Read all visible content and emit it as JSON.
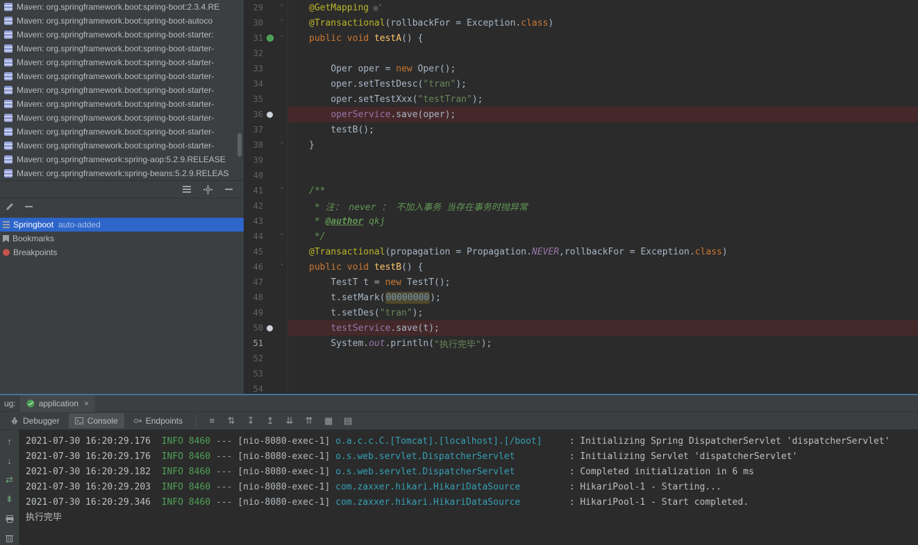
{
  "project_tree": {
    "items": [
      "Maven: org.springframework.boot:spring-boot:2.3.4.RE",
      "Maven: org.springframework.boot:spring-boot-autoco",
      "Maven: org.springframework.boot:spring-boot-starter:",
      "Maven: org.springframework.boot:spring-boot-starter-",
      "Maven: org.springframework.boot:spring-boot-starter-",
      "Maven: org.springframework.boot:spring-boot-starter-",
      "Maven: org.springframework.boot:spring-boot-starter-",
      "Maven: org.springframework.boot:spring-boot-starter-",
      "Maven: org.springframework.boot:spring-boot-starter-",
      "Maven: org.springframework.boot:spring-boot-starter-",
      "Maven: org.springframework.boot:spring-boot-starter-",
      "Maven: org.springframework:spring-aop:5.2.9.RELEASE",
      "Maven: org.springframework:spring-beans:5.2.9.RELEAS"
    ]
  },
  "favorites": {
    "items": [
      {
        "label": "Springboot",
        "suffix": "auto-added",
        "icon": "favorites-list",
        "selected": true
      },
      {
        "label": "Bookmarks",
        "suffix": "",
        "icon": "bookmark",
        "selected": false
      },
      {
        "label": "Breakpoints",
        "suffix": "",
        "icon": "breakpoint",
        "selected": false
      }
    ]
  },
  "editor": {
    "lines": [
      {
        "n": 29,
        "f": "v",
        "t": [
          [
            "a",
            "@GetMapping"
          ],
          [
            "ic",
            " ◎ˇ"
          ]
        ]
      },
      {
        "n": 30,
        "f": "v",
        "t": [
          [
            "a",
            "@Transactional"
          ],
          [
            "p",
            "(rollbackFor = Exception."
          ],
          [
            "k",
            "class"
          ],
          [
            "p",
            ")"
          ]
        ]
      },
      {
        "n": 31,
        "g": "bean",
        "f": "v",
        "t": [
          [
            "k",
            "public"
          ],
          [
            "p",
            " "
          ],
          [
            "k",
            "void"
          ],
          [
            "p",
            " "
          ],
          [
            "m",
            "testA"
          ],
          [
            "p",
            "() {"
          ]
        ]
      },
      {
        "n": 32,
        "t": []
      },
      {
        "n": 33,
        "t": [
          [
            "p",
            "    Oper oper = "
          ],
          [
            "k",
            "new"
          ],
          [
            "p",
            " Oper();"
          ]
        ]
      },
      {
        "n": 34,
        "t": [
          [
            "p",
            "    oper.setTestDesc("
          ],
          [
            "s",
            "\"tran\""
          ],
          [
            "p",
            ");"
          ]
        ]
      },
      {
        "n": 35,
        "t": [
          [
            "p",
            "    oper.setTestXxx("
          ],
          [
            "s",
            "\"testTran\""
          ],
          [
            "p",
            ");"
          ]
        ]
      },
      {
        "n": 36,
        "g": "bp",
        "hl": true,
        "t": [
          [
            "p",
            "    "
          ],
          [
            "f",
            "operService"
          ],
          [
            "p",
            ".save(oper);"
          ]
        ]
      },
      {
        "n": 37,
        "t": [
          [
            "p",
            "    testB();"
          ]
        ]
      },
      {
        "n": 38,
        "f": "^",
        "t": [
          [
            "p",
            "}"
          ]
        ]
      },
      {
        "n": 39,
        "t": []
      },
      {
        "n": 40,
        "t": []
      },
      {
        "n": 41,
        "f": "v",
        "t": [
          [
            "c",
            "/**"
          ]
        ]
      },
      {
        "n": 42,
        "t": [
          [
            "c",
            " * 注： never ： 不加入事务 当存在事务时抛异常"
          ]
        ]
      },
      {
        "n": 43,
        "t": [
          [
            "c",
            " * "
          ],
          [
            "ct",
            "@author"
          ],
          [
            "ci",
            " qkj"
          ]
        ]
      },
      {
        "n": 44,
        "f": "^",
        "t": [
          [
            "c",
            " */"
          ]
        ]
      },
      {
        "n": 45,
        "t": [
          [
            "a",
            "@Transactional"
          ],
          [
            "p",
            "(propagation = Propagation."
          ],
          [
            "fi",
            "NEVER"
          ],
          [
            "p",
            ",rollbackFor = Exception."
          ],
          [
            "k",
            "class"
          ],
          [
            "p",
            ")"
          ]
        ]
      },
      {
        "n": 46,
        "f": "v",
        "t": [
          [
            "k",
            "public"
          ],
          [
            "p",
            " "
          ],
          [
            "k",
            "void"
          ],
          [
            "p",
            " "
          ],
          [
            "m",
            "testB"
          ],
          [
            "p",
            "() {"
          ]
        ]
      },
      {
        "n": 47,
        "t": [
          [
            "p",
            "    TestT t = "
          ],
          [
            "k",
            "new"
          ],
          [
            "p",
            " TestT();"
          ]
        ]
      },
      {
        "n": 48,
        "t": [
          [
            "p",
            "    t.setMark("
          ],
          [
            "nh",
            "00000000"
          ],
          [
            "p",
            ");"
          ]
        ]
      },
      {
        "n": 49,
        "t": [
          [
            "p",
            "    t.setDes("
          ],
          [
            "s",
            "\"tran\""
          ],
          [
            "p",
            ");"
          ]
        ]
      },
      {
        "n": 50,
        "g": "bp",
        "hl": true,
        "t": [
          [
            "p",
            "    "
          ],
          [
            "f",
            "testService"
          ],
          [
            "p",
            ".save(t);"
          ]
        ]
      },
      {
        "n": 51,
        "cur": true,
        "t": [
          [
            "p",
            "    System."
          ],
          [
            "fi",
            "out"
          ],
          [
            "p",
            ".println("
          ],
          [
            "s",
            "\"执行完毕\""
          ],
          [
            "p",
            ");"
          ]
        ]
      },
      {
        "n": 52,
        "t": []
      },
      {
        "n": 53,
        "t": []
      },
      {
        "n": 54,
        "t": []
      }
    ]
  },
  "debug": {
    "pane_prefix": "ug:",
    "tab": {
      "label": "application",
      "close": "×"
    },
    "views": [
      {
        "label": "Debugger"
      },
      {
        "label": "Console"
      },
      {
        "label": "Endpoints"
      }
    ],
    "toolbar_icons": [
      {
        "name": "restore-layout-icon",
        "glyph": "≡"
      },
      {
        "name": "sort-icon",
        "glyph": "⇅"
      },
      {
        "name": "scroll-down-icon",
        "glyph": "↧"
      },
      {
        "name": "scroll-up-icon",
        "glyph": "↥"
      },
      {
        "name": "move-down-icon",
        "glyph": "⇊"
      },
      {
        "name": "move-up-icon",
        "glyph": "⇈"
      },
      {
        "name": "table-view-icon",
        "glyph": "▦"
      },
      {
        "name": "grid-settings-icon",
        "glyph": "▤"
      }
    ],
    "rail_icons": [
      {
        "name": "prev-occurrence-icon",
        "glyph": "↑"
      },
      {
        "name": "next-occurrence-icon",
        "glyph": "↓"
      },
      {
        "name": "soft-wrap-icon",
        "glyph": "⇄",
        "accent": true
      },
      {
        "name": "scroll-to-end-icon",
        "glyph": "⇟",
        "accent": true
      },
      {
        "name": "print-icon",
        "shape": "print"
      },
      {
        "name": "clear-console-icon",
        "shape": "trash"
      }
    ],
    "console": {
      "lines": [
        {
          "time": "2021-07-30 16:20:29.176",
          "level": "INFO",
          "pid": "8460",
          "thread": "[nio-8080-exec-1]",
          "logger": "o.a.c.c.C.[Tomcat].[localhost].[/boot]",
          "msg": "Initializing Spring DispatcherServlet 'dispatcherServlet'"
        },
        {
          "time": "2021-07-30 16:20:29.176",
          "level": "INFO",
          "pid": "8460",
          "thread": "[nio-8080-exec-1]",
          "logger": "o.s.web.servlet.DispatcherServlet",
          "msg": "Initializing Servlet 'dispatcherServlet'"
        },
        {
          "time": "2021-07-30 16:20:29.182",
          "level": "INFO",
          "pid": "8460",
          "thread": "[nio-8080-exec-1]",
          "logger": "o.s.web.servlet.DispatcherServlet",
          "msg": "Completed initialization in 6 ms"
        },
        {
          "time": "2021-07-30 16:20:29.203",
          "level": "INFO",
          "pid": "8460",
          "thread": "[nio-8080-exec-1]",
          "logger": "com.zaxxer.hikari.HikariDataSource",
          "msg": "HikariPool-1 - Starting..."
        },
        {
          "time": "2021-07-30 16:20:29.346",
          "level": "INFO",
          "pid": "8460",
          "thread": "[nio-8080-exec-1]",
          "logger": "com.zaxxer.hikari.HikariDataSource",
          "msg": "HikariPool-1 - Start completed."
        }
      ],
      "stdout": "执行完毕"
    }
  }
}
